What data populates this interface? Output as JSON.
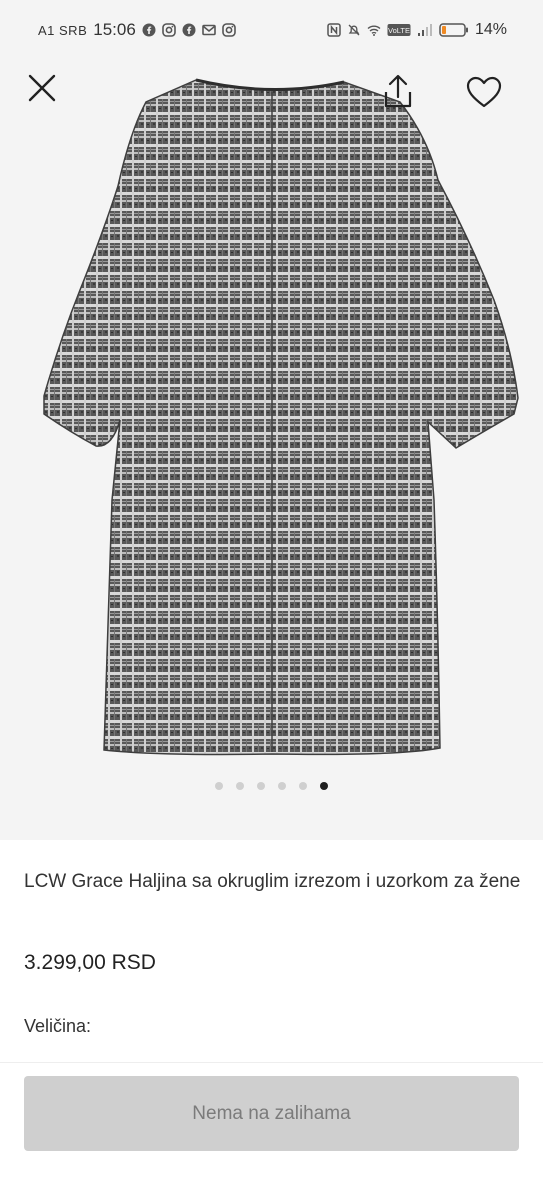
{
  "status_bar": {
    "carrier": "A1 SRB",
    "time": "15:06",
    "battery": "14%",
    "network": "VoLTE",
    "notification_icons": [
      "facebook-icon",
      "instagram-icon",
      "facebook-icon",
      "gmail-icon",
      "instagram-icon"
    ],
    "system_icons": [
      "nfc-icon",
      "mute-icon",
      "wifi-icon",
      "volte-icon",
      "signal-icon",
      "battery-icon"
    ]
  },
  "toolbar": {
    "icons": [
      "close-icon",
      "share-icon",
      "heart-icon"
    ]
  },
  "gallery": {
    "image_count": 6,
    "active_index": 5,
    "colors": {
      "background": "#f4f4f4",
      "fabric": "#5a5a5a",
      "check_light": "#d8d8d8",
      "dot_inactive": "#cfcfcf",
      "dot_active": "#1f1f1f"
    }
  },
  "product": {
    "title": "LCW Grace Haljina sa okruglim izrezom i uzorkom za žene",
    "price": "3.299,00 RSD",
    "size_label": "Veličina:"
  },
  "cta": {
    "label": "Nema na zalihama",
    "colors": {
      "background": "#cfcfcf",
      "text": "#7b7b7b"
    }
  }
}
